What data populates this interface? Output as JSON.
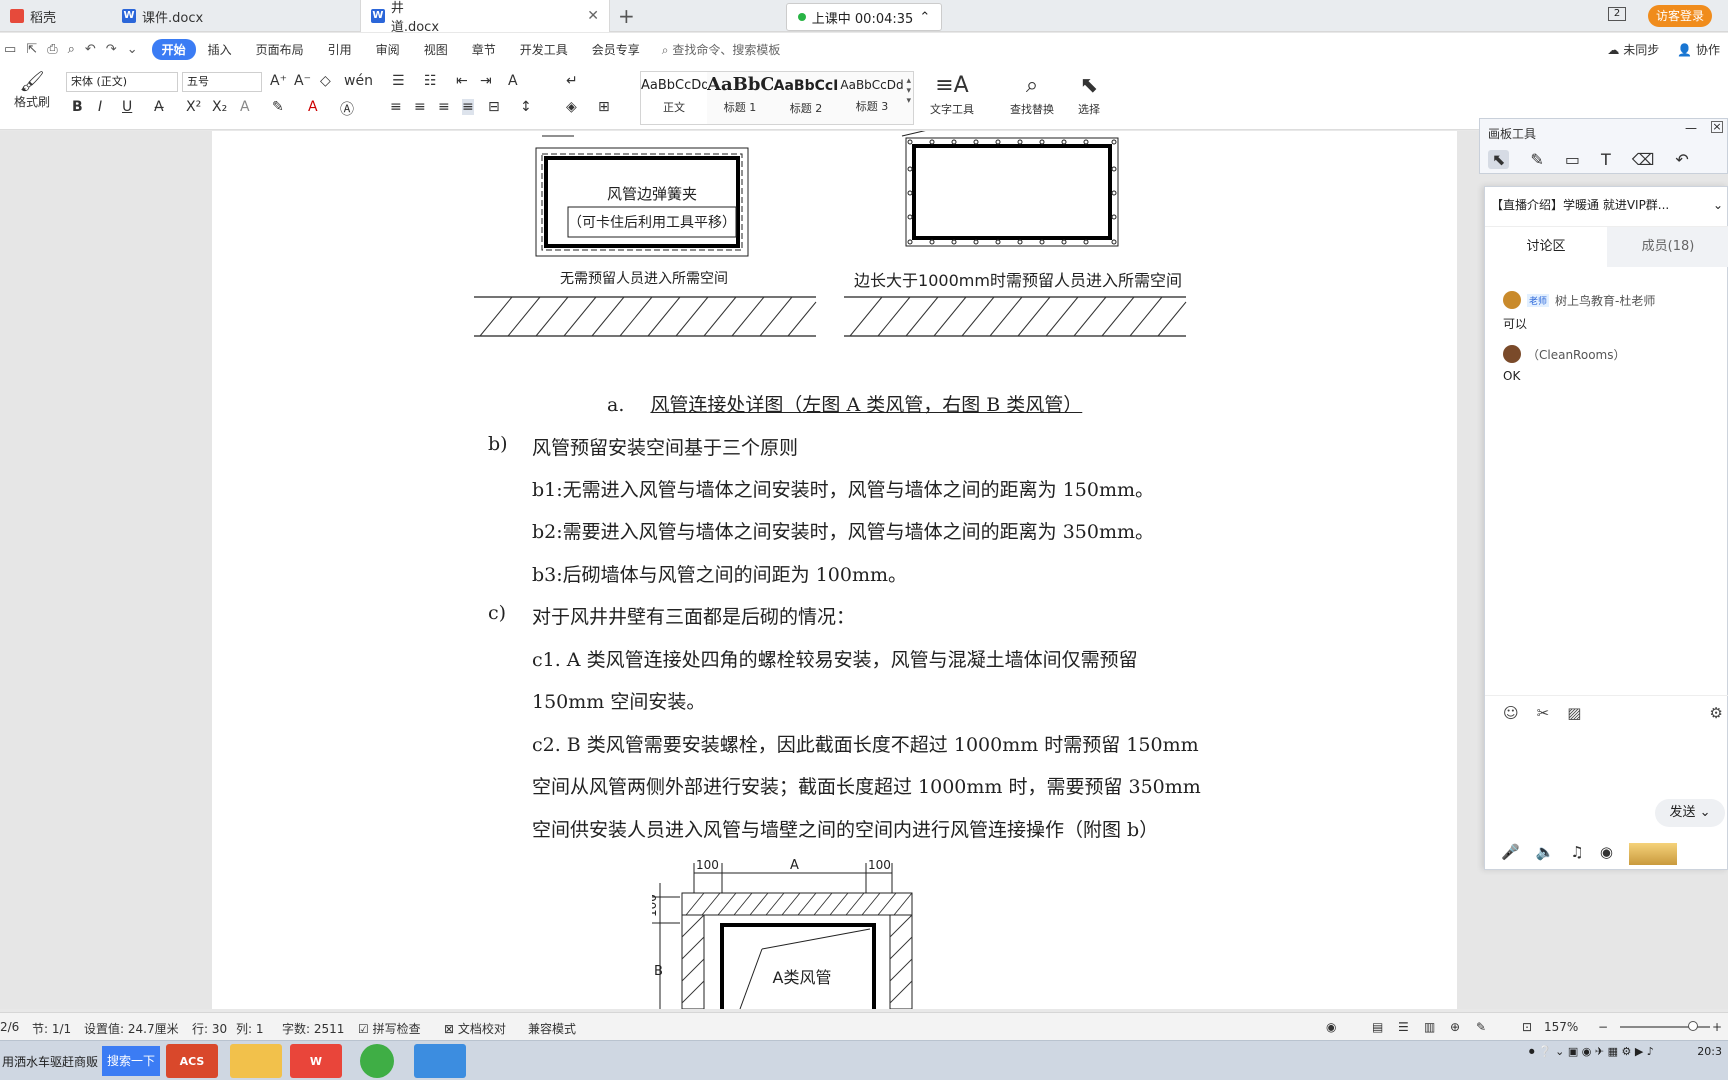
{
  "tabs": [
    {
      "label": "稻壳"
    },
    {
      "label": "课件.docx"
    },
    {
      "label": "井道.docx"
    }
  ],
  "class_timer": "上课中 00:04:35",
  "window_num": "2",
  "guest_login": "访客登录",
  "menu": {
    "items": [
      "开始",
      "插入",
      "页面布局",
      "引用",
      "审阅",
      "视图",
      "章节",
      "开发工具",
      "会员专享"
    ],
    "search": "查找命令、搜索模板",
    "right": [
      "未同步",
      "协作"
    ]
  },
  "ribbon": {
    "format_painter": "格式刷",
    "font_name": "宋体 (正文)",
    "font_size": "五号",
    "styles": [
      {
        "preview": "AaBbCcDd",
        "label": "正文"
      },
      {
        "preview": "AaBbC",
        "label": "标题 1"
      },
      {
        "preview": "AaBbCcI",
        "label": "标题 2"
      },
      {
        "preview": "AaBbCcDd",
        "label": "标题 3"
      }
    ],
    "text_tools": "文字工具",
    "find_replace": "查找替换",
    "select": "选择"
  },
  "document": {
    "fig_left_label1": "风管边弹簧夹",
    "fig_left_label2": "（可卡住后利用工具平移）",
    "fig_left_caption": "无需预留人员进入所需空间",
    "fig_right_caption": "边长大于1000mm时需预留人员进入所需空间",
    "caption_num": "a.",
    "caption_text": "风管连接处详图（左图 A 类风管，右图 B 类风管）",
    "b_label": "b)",
    "b_text": "风管预留安装空间基于三个原则",
    "b1": "b1:无需进入风管与墙体之间安装时，风管与墙体之间的距离为 150mm。",
    "b2": "b2:需要进入风管与墙体之间安装时，风管与墙体之间的距离为 350mm。",
    "b3": "b3:后砌墙体与风管之间的间距为 100mm。",
    "c_label": "c)",
    "c_text": "对于风井井壁有三面都是后砌的情况：",
    "c1_line1": "c1. A 类风管连接处四角的螺栓较易安装，风管与混凝土墙体间仅需预留",
    "c1_line2": "150mm 空间安装。",
    "c2_line1": "c2. B 类风管需要安装螺栓，因此截面长度不超过 1000mm 时需预留 150mm",
    "c2_line2": "空间从风管两侧外部进行安装；截面长度超过 1000mm 时，需要预留 350mm",
    "c2_line3": "空间供安装人员进入风管与墙壁之间的空间内进行风管连接操作（附图 b）",
    "fig_bottom_dim_left": "100",
    "fig_bottom_dim_a": "A",
    "fig_bottom_dim_right": "100",
    "fig_bottom_dim_side": "100",
    "fig_bottom_dim_b": "B",
    "fig_bottom_label": "A类风管"
  },
  "statusbar": {
    "page": "2/6",
    "section": "节: 1/1",
    "setting": "设置值: 24.7厘米",
    "row": "行: 30",
    "col": "列: 1",
    "words": "字数: 2511",
    "spell": "拼写检查",
    "proof": "文档校对",
    "compat": "兼容模式",
    "zoom": "157%"
  },
  "taskbar": {
    "left_text": "用洒水车驱赶商贩",
    "search": "搜索一下",
    "apps": [
      "ACS",
      "",
      "W",
      "",
      ""
    ],
    "clock": "20:3"
  },
  "board": {
    "title": "画板工具"
  },
  "chat": {
    "header": "【直播介绍】学暖通 就进VIP群...",
    "tab_discuss": "讨论区",
    "tab_members": "成员(18)",
    "messages": [
      {
        "role": "老师",
        "name": "树上鸟教育-杜老师",
        "text": "可以"
      },
      {
        "role": "",
        "name": "（CleanRooms）",
        "text": "OK"
      }
    ],
    "send": "发送"
  },
  "colors": {
    "accent": "#3b7cf4",
    "guest": "#f08c1c",
    "live": "#28b445"
  }
}
